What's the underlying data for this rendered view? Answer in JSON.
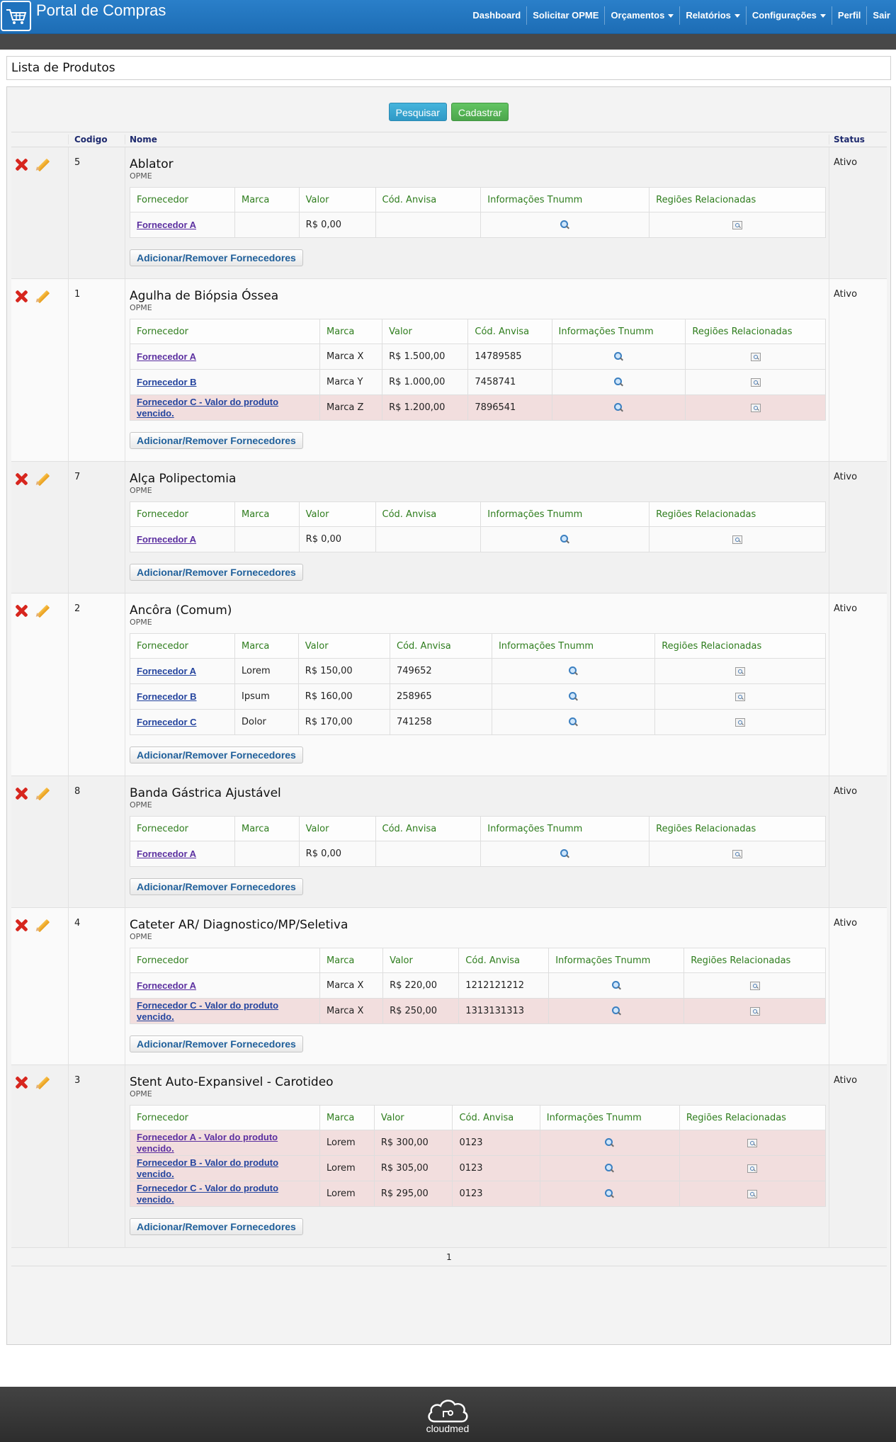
{
  "header": {
    "title": "Portal de Compras",
    "nav": [
      {
        "label": "Dashboard",
        "dropdown": false
      },
      {
        "label": "Solicitar OPME",
        "dropdown": false
      },
      {
        "label": "Orçamentos",
        "dropdown": true
      },
      {
        "label": "Relatórios",
        "dropdown": true
      },
      {
        "label": "Configurações",
        "dropdown": true
      },
      {
        "label": "Perfil",
        "dropdown": false
      },
      {
        "label": "Sair",
        "dropdown": false
      }
    ]
  },
  "page": {
    "title": "Lista de Produtos",
    "search_button": "Pesquisar",
    "register_button": "Cadastrar",
    "columns": {
      "code": "Codigo",
      "name": "Nome",
      "status": "Status"
    },
    "supplier_columns": [
      "Fornecedor",
      "Marca",
      "Valor",
      "Cód. Anvisa",
      "Informações Tnumm",
      "Regiões Relacionadas"
    ],
    "add_button": "Adicionar/Remover Fornecedores",
    "pagination": "1"
  },
  "products": [
    {
      "code": "5",
      "name": "Ablator",
      "category": "OPME",
      "status": "Ativo",
      "suppliers": [
        {
          "name": "Fornecedor A",
          "brand": "",
          "value": "R$ 0,00",
          "anvisa": "",
          "expired": false,
          "visited": true
        }
      ]
    },
    {
      "code": "1",
      "name": "Agulha de Biópsia Óssea",
      "category": "OPME",
      "status": "Ativo",
      "suppliers": [
        {
          "name": "Fornecedor A",
          "brand": "Marca X",
          "value": "R$ 1.500,00",
          "anvisa": "14789585",
          "expired": false,
          "visited": true
        },
        {
          "name": "Fornecedor B",
          "brand": "Marca Y",
          "value": "R$ 1.000,00",
          "anvisa": "7458741",
          "expired": false,
          "visited": false
        },
        {
          "name": "Fornecedor C - Valor do produto vencido.",
          "brand": "Marca Z",
          "value": "R$ 1.200,00",
          "anvisa": "7896541",
          "expired": true,
          "visited": false
        }
      ]
    },
    {
      "code": "7",
      "name": "Alça Polipectomia",
      "category": "OPME",
      "status": "Ativo",
      "suppliers": [
        {
          "name": "Fornecedor A",
          "brand": "",
          "value": "R$ 0,00",
          "anvisa": "",
          "expired": false,
          "visited": true
        }
      ]
    },
    {
      "code": "2",
      "name": "Ancôra (Comum)",
      "category": "OPME",
      "status": "Ativo",
      "suppliers": [
        {
          "name": "Fornecedor A",
          "brand": "Lorem",
          "value": "R$ 150,00",
          "anvisa": "749652",
          "expired": false,
          "visited": false
        },
        {
          "name": "Fornecedor B",
          "brand": "Ipsum",
          "value": "R$ 160,00",
          "anvisa": "258965",
          "expired": false,
          "visited": false
        },
        {
          "name": "Fornecedor C",
          "brand": "Dolor",
          "value": "R$ 170,00",
          "anvisa": "741258",
          "expired": false,
          "visited": false
        }
      ]
    },
    {
      "code": "8",
      "name": "Banda Gástrica Ajustável",
      "category": "OPME",
      "status": "Ativo",
      "suppliers": [
        {
          "name": "Fornecedor A",
          "brand": "",
          "value": "R$ 0,00",
          "anvisa": "",
          "expired": false,
          "visited": true
        }
      ]
    },
    {
      "code": "4",
      "name": "Cateter AR/ Diagnostico/MP/Seletiva",
      "category": "OPME",
      "status": "Ativo",
      "suppliers": [
        {
          "name": "Fornecedor A",
          "brand": "Marca X",
          "value": "R$ 220,00",
          "anvisa": "1212121212",
          "expired": false,
          "visited": true
        },
        {
          "name": "Fornecedor C - Valor do produto vencido.",
          "brand": "Marca X",
          "value": "R$ 250,00",
          "anvisa": "1313131313",
          "expired": true,
          "visited": false
        }
      ]
    },
    {
      "code": "3",
      "name": "Stent Auto-Expansivel - Carotideo",
      "category": "OPME",
      "status": "Ativo",
      "suppliers": [
        {
          "name": "Fornecedor A - Valor do produto vencido.",
          "brand": "Lorem",
          "value": "R$ 300,00",
          "anvisa": "0123",
          "expired": true,
          "visited": true
        },
        {
          "name": "Fornecedor B - Valor do produto vencido.",
          "brand": "Lorem",
          "value": "R$ 305,00",
          "anvisa": "0123",
          "expired": true,
          "visited": false
        },
        {
          "name": "Fornecedor C - Valor do produto vencido.",
          "brand": "Lorem",
          "value": "R$ 295,00",
          "anvisa": "0123",
          "expired": true,
          "visited": false
        }
      ]
    }
  ],
  "footer": {
    "brand": "cloudmed"
  },
  "icons": {
    "delete": "delete-x-icon",
    "edit": "pencil-edit-icon",
    "tnumm": "magnifier-icon",
    "regions": "document-search-icon",
    "cart": "shopping-cart-icon",
    "cloud": "cloud-icon"
  },
  "colors": {
    "header": "#1d6db5",
    "expired_row": "#f2dede",
    "supplier_header": "#2e7d1d",
    "link": "#24449e",
    "footer": "#2d2d2d"
  }
}
